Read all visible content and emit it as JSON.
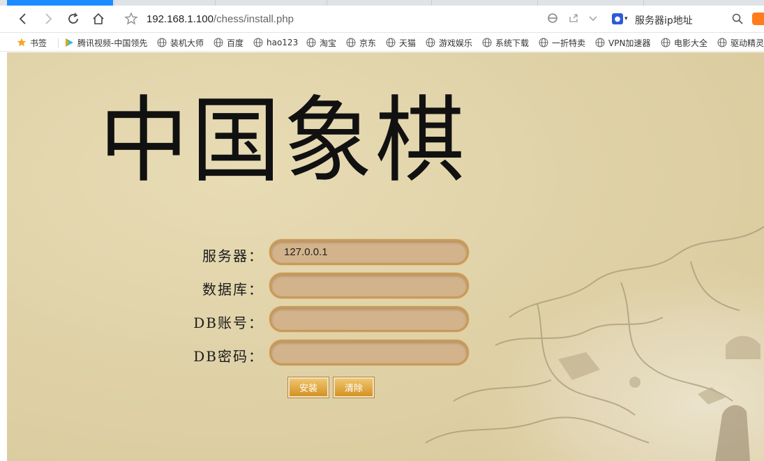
{
  "browser": {
    "url_host": "192.168.1.100",
    "url_path": "/chess/install.php",
    "search_placeholder": "服务器ip地址"
  },
  "bookmarks": [
    {
      "label": "书签",
      "icon": "star-icon"
    },
    {
      "label": "腾讯视频-中国领先",
      "icon": "tencent-video-icon"
    },
    {
      "label": "装机大师",
      "icon": "globe-icon"
    },
    {
      "label": "百度",
      "icon": "globe-icon"
    },
    {
      "label": "hao123",
      "icon": "globe-icon"
    },
    {
      "label": "淘宝",
      "icon": "globe-icon"
    },
    {
      "label": "京东",
      "icon": "globe-icon"
    },
    {
      "label": "天猫",
      "icon": "globe-icon"
    },
    {
      "label": "游戏娱乐",
      "icon": "globe-icon"
    },
    {
      "label": "系统下载",
      "icon": "globe-icon"
    },
    {
      "label": "一折特卖",
      "icon": "globe-icon"
    },
    {
      "label": "VPN加速器",
      "icon": "globe-icon"
    },
    {
      "label": "电影大全",
      "icon": "globe-icon"
    },
    {
      "label": "驱动精灵",
      "icon": "globe-icon"
    }
  ],
  "page": {
    "title": "中国象棋",
    "form": {
      "server_label": "服务器：",
      "server_value": "127.0.0.1",
      "database_label": "数据库：",
      "database_value": "",
      "db_user_label": "DB账号：",
      "db_user_value": "",
      "db_password_label": "DB密码：",
      "db_password_value": ""
    },
    "install_button": "安装",
    "clear_button": "清除"
  },
  "colors": {
    "accent_tab": "#1a8cff",
    "page_background": "#e0d2a8",
    "input_fill": "#d3b38b",
    "button_fill": "#d49123"
  }
}
